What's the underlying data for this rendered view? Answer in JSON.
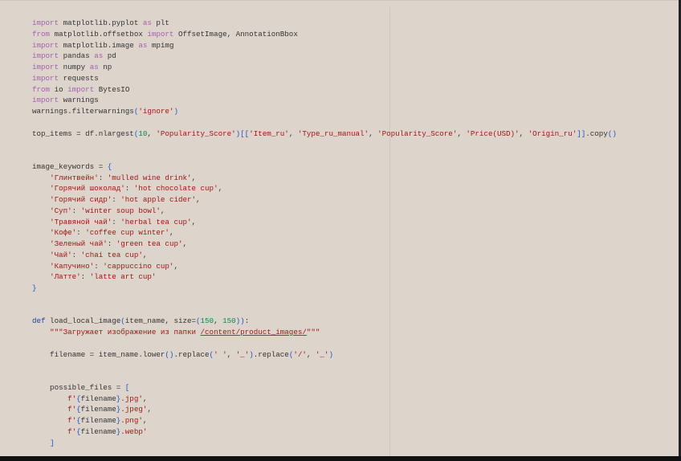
{
  "editor": {
    "language": "python",
    "colors": {
      "keyword": "#a45fae",
      "def": "#1f3f9f",
      "string": "#a31515",
      "number": "#098658",
      "bracket": "#2255cc",
      "text": "#333333",
      "background": "#ddd5cc"
    },
    "lines": [
      [
        [
          "k",
          "import"
        ],
        [
          "t",
          " matplotlib.pyplot "
        ],
        [
          "k",
          "as"
        ],
        [
          "t",
          " plt"
        ]
      ],
      [
        [
          "k",
          "from"
        ],
        [
          "t",
          " matplotlib.offsetbox "
        ],
        [
          "k",
          "import"
        ],
        [
          "t",
          " OffsetImage, AnnotationBbox"
        ]
      ],
      [
        [
          "k",
          "import"
        ],
        [
          "t",
          " matplotlib.image "
        ],
        [
          "k",
          "as"
        ],
        [
          "t",
          " mpimg"
        ]
      ],
      [
        [
          "k",
          "import"
        ],
        [
          "t",
          " pandas "
        ],
        [
          "k",
          "as"
        ],
        [
          "t",
          " pd"
        ]
      ],
      [
        [
          "k",
          "import"
        ],
        [
          "t",
          " numpy "
        ],
        [
          "k",
          "as"
        ],
        [
          "t",
          " np"
        ]
      ],
      [
        [
          "k",
          "import"
        ],
        [
          "t",
          " requests"
        ]
      ],
      [
        [
          "k",
          "from"
        ],
        [
          "t",
          " io "
        ],
        [
          "k",
          "import"
        ],
        [
          "t",
          " BytesIO"
        ]
      ],
      [
        [
          "k",
          "import"
        ],
        [
          "t",
          " warnings"
        ]
      ],
      [
        [
          "t",
          "warnings.filterwarnings"
        ],
        [
          "p",
          "("
        ],
        [
          "s",
          "'ignore'"
        ],
        [
          "p",
          ")"
        ]
      ],
      [],
      [
        [
          "t",
          "top_items = df.nlargest"
        ],
        [
          "p",
          "("
        ],
        [
          "n",
          "10"
        ],
        [
          "t",
          ", "
        ],
        [
          "s",
          "'Popularity_Score'"
        ],
        [
          "p",
          ")[["
        ],
        [
          "s",
          "'Item_ru'"
        ],
        [
          "t",
          ", "
        ],
        [
          "s",
          "'Type_ru_manual'"
        ],
        [
          "t",
          ", "
        ],
        [
          "s",
          "'Popularity_Score'"
        ],
        [
          "t",
          ", "
        ],
        [
          "s",
          "'Price(USD)'"
        ],
        [
          "t",
          ", "
        ],
        [
          "s",
          "'Origin_ru'"
        ],
        [
          "p",
          "]]"
        ],
        [
          "t",
          ".copy"
        ],
        [
          "p",
          "()"
        ]
      ],
      [],
      [],
      [
        [
          "t",
          "image_keywords = "
        ],
        [
          "p",
          "{"
        ]
      ],
      [
        [
          "t",
          "    "
        ],
        [
          "s",
          "'Глинтвейн'"
        ],
        [
          "t",
          ": "
        ],
        [
          "s",
          "'mulled wine drink'"
        ],
        [
          "t",
          ","
        ]
      ],
      [
        [
          "t",
          "    "
        ],
        [
          "s",
          "'Горячий шоколад'"
        ],
        [
          "t",
          ": "
        ],
        [
          "s",
          "'hot chocolate cup'"
        ],
        [
          "t",
          ","
        ]
      ],
      [
        [
          "t",
          "    "
        ],
        [
          "s",
          "'Горячий сидр'"
        ],
        [
          "t",
          ": "
        ],
        [
          "s",
          "'hot apple cider'"
        ],
        [
          "t",
          ","
        ]
      ],
      [
        [
          "t",
          "    "
        ],
        [
          "s",
          "'Суп'"
        ],
        [
          "t",
          ": "
        ],
        [
          "s",
          "'winter soup bowl'"
        ],
        [
          "t",
          ","
        ]
      ],
      [
        [
          "t",
          "    "
        ],
        [
          "s",
          "'Травяной чай'"
        ],
        [
          "t",
          ": "
        ],
        [
          "s",
          "'herbal tea cup'"
        ],
        [
          "t",
          ","
        ]
      ],
      [
        [
          "t",
          "    "
        ],
        [
          "s",
          "'Кофе'"
        ],
        [
          "t",
          ": "
        ],
        [
          "s",
          "'coffee cup winter'"
        ],
        [
          "t",
          ","
        ]
      ],
      [
        [
          "t",
          "    "
        ],
        [
          "s",
          "'Зеленый чай'"
        ],
        [
          "t",
          ": "
        ],
        [
          "s",
          "'green tea cup'"
        ],
        [
          "t",
          ","
        ]
      ],
      [
        [
          "t",
          "    "
        ],
        [
          "s",
          "'Чай'"
        ],
        [
          "t",
          ": "
        ],
        [
          "s",
          "'chai tea cup'"
        ],
        [
          "t",
          ","
        ]
      ],
      [
        [
          "t",
          "    "
        ],
        [
          "s",
          "'Капучино'"
        ],
        [
          "t",
          ": "
        ],
        [
          "s",
          "'cappuccino cup'"
        ],
        [
          "t",
          ","
        ]
      ],
      [
        [
          "t",
          "    "
        ],
        [
          "s",
          "'Латте'"
        ],
        [
          "t",
          ": "
        ],
        [
          "s",
          "'latte art cup'"
        ]
      ],
      [
        [
          "p",
          "}"
        ]
      ],
      [],
      [],
      [
        [
          "d",
          "def"
        ],
        [
          "t",
          " load_local_image"
        ],
        [
          "p",
          "("
        ],
        [
          "t",
          "item_name, size="
        ],
        [
          "p",
          "("
        ],
        [
          "n",
          "150"
        ],
        [
          "t",
          ", "
        ],
        [
          "n",
          "150"
        ],
        [
          "p",
          "))"
        ],
        [
          "t",
          ":"
        ]
      ],
      [
        [
          "t",
          "    "
        ],
        [
          "s",
          "\"\"\"Загружает изображение из папки "
        ],
        [
          "u",
          "/content/product_images/"
        ],
        [
          "s",
          "\"\"\""
        ]
      ],
      [],
      [
        [
          "t",
          "    filename = item_name.lower"
        ],
        [
          "p",
          "()"
        ],
        [
          "t",
          ".replace"
        ],
        [
          "p",
          "("
        ],
        [
          "s",
          "' '"
        ],
        [
          "t",
          ", "
        ],
        [
          "s",
          "'_'"
        ],
        [
          "p",
          ")"
        ],
        [
          "t",
          ".replace"
        ],
        [
          "p",
          "("
        ],
        [
          "s",
          "'/'"
        ],
        [
          "t",
          ", "
        ],
        [
          "s",
          "'_'"
        ],
        [
          "p",
          ")"
        ]
      ],
      [],
      [],
      [
        [
          "t",
          "    possible_files = "
        ],
        [
          "p",
          "["
        ]
      ],
      [
        [
          "t",
          "        "
        ],
        [
          "s",
          "f'"
        ],
        [
          "p",
          "{"
        ],
        [
          "t",
          "filename"
        ],
        [
          "p",
          "}"
        ],
        [
          "s",
          ".jpg'"
        ],
        [
          "t",
          ","
        ]
      ],
      [
        [
          "t",
          "        "
        ],
        [
          "s",
          "f'"
        ],
        [
          "p",
          "{"
        ],
        [
          "t",
          "filename"
        ],
        [
          "p",
          "}"
        ],
        [
          "s",
          ".jpeg'"
        ],
        [
          "t",
          ","
        ]
      ],
      [
        [
          "t",
          "        "
        ],
        [
          "s",
          "f'"
        ],
        [
          "p",
          "{"
        ],
        [
          "t",
          "filename"
        ],
        [
          "p",
          "}"
        ],
        [
          "s",
          ".png'"
        ],
        [
          "t",
          ","
        ]
      ],
      [
        [
          "t",
          "        "
        ],
        [
          "s",
          "f'"
        ],
        [
          "p",
          "{"
        ],
        [
          "t",
          "filename"
        ],
        [
          "p",
          "}"
        ],
        [
          "s",
          ".webp'"
        ]
      ],
      [
        [
          "t",
          "    "
        ],
        [
          "p",
          "]"
        ]
      ]
    ]
  }
}
